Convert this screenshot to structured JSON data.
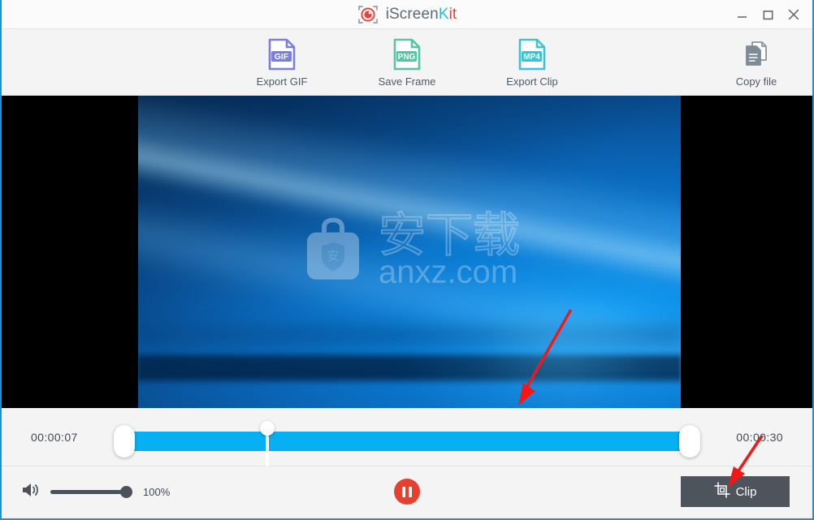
{
  "window": {
    "app_name_full": "iScreenKit",
    "app_name_part1": "iScreen",
    "app_name_part2": "K",
    "app_name_part3": "it",
    "logo_icon": "target-camera-icon",
    "minimize_label": "Minimize",
    "maximize_label": "Maximize",
    "close_label": "Close",
    "accent_border": "#1e90d6"
  },
  "toolbar": {
    "items": [
      {
        "label": "Export GIF",
        "icon": "gif-file-icon",
        "badge": "GIF",
        "color": "#7b7fdc"
      },
      {
        "label": "Save Frame",
        "icon": "png-file-icon",
        "badge": "PNG",
        "color": "#56c5a5"
      },
      {
        "label": "Export Clip",
        "icon": "mp4-file-icon",
        "badge": "MP4",
        "color": "#3cc4d4"
      }
    ],
    "copy_file": {
      "label": "Copy file",
      "icon": "copy-file-icon",
      "color": "#7e8a94"
    }
  },
  "video": {
    "watermark_site": "anxz.com",
    "watermark_cn": "安下载",
    "watermark_badge": "安",
    "watermark_logo": "bag-shield-icon"
  },
  "timeline": {
    "start_time": "00:00:07",
    "end_time": "00:00:30",
    "fill_color": "#07b0f2",
    "playhead_position_pct": "31"
  },
  "controls": {
    "volume_icon": "speaker-volume-icon",
    "volume_percent": "100%",
    "play_state_icon": "pause-icon",
    "play_button_color": "#e8402f",
    "clip_button": {
      "label": "Clip",
      "icon": "crop-clip-icon"
    }
  },
  "annotations": {
    "arrow_video": "red-arrow-down-left",
    "arrow_clip": "red-arrow-down-left",
    "arrow_color": "#f51616"
  }
}
